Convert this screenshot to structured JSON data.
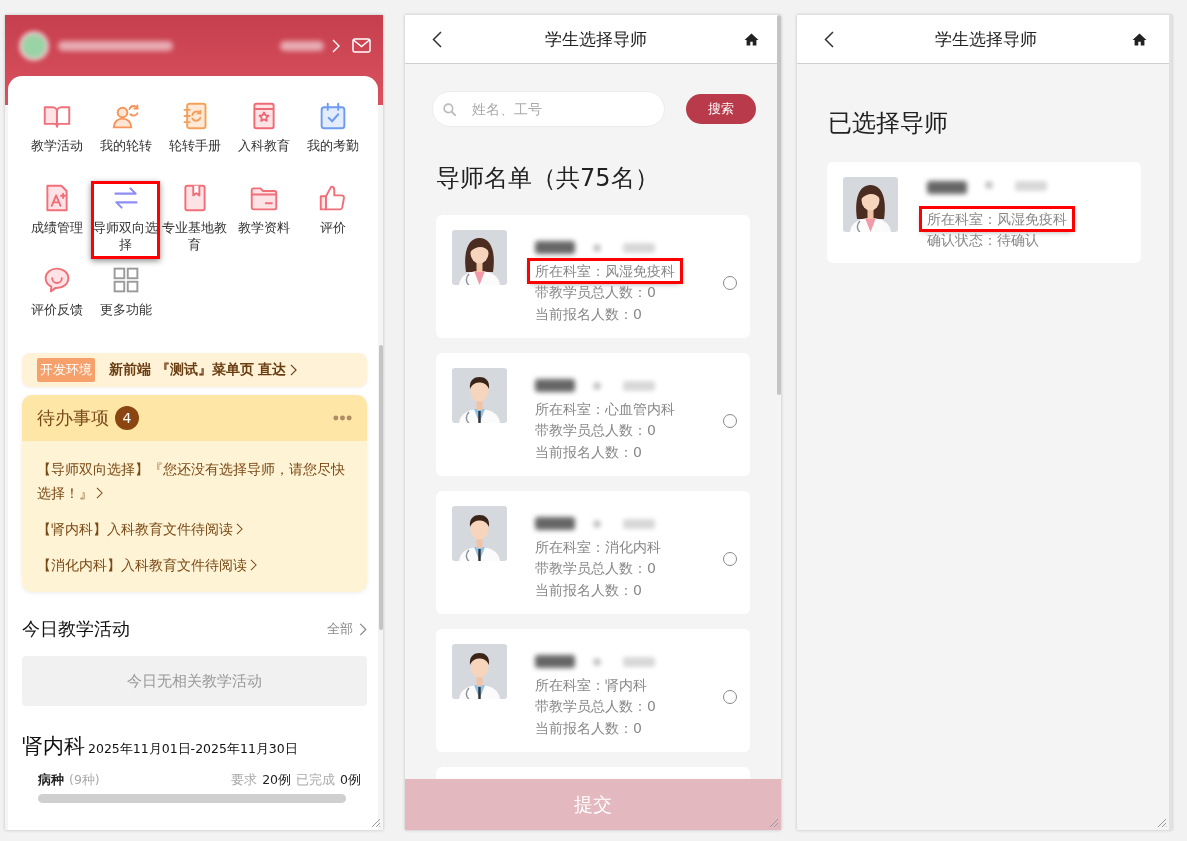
{
  "home_panel": {
    "header": {
      "identity_blurred": true
    },
    "menu": [
      {
        "label": "教学活动",
        "highlighted": false
      },
      {
        "label": "我的轮转",
        "highlighted": false
      },
      {
        "label": "轮转手册",
        "highlighted": false
      },
      {
        "label": "入科教育",
        "highlighted": false
      },
      {
        "label": "我的考勤",
        "highlighted": false
      },
      {
        "label": "成绩管理",
        "highlighted": false
      },
      {
        "label": "导师双向选择",
        "highlighted": true
      },
      {
        "label": "专业基地教育",
        "highlighted": false
      },
      {
        "label": "教学资料",
        "highlighted": false
      },
      {
        "label": "评价",
        "highlighted": false
      },
      {
        "label": "评价反馈",
        "highlighted": false
      },
      {
        "label": "更多功能",
        "highlighted": false
      }
    ],
    "dev_banner": {
      "tag": "开发环境",
      "text": "新前端 『测试』菜单页 直达"
    },
    "todo": {
      "title": "待办事项",
      "count": "4",
      "items": [
        "【导师双向选择】『您还没有选择导师，请您尽快选择！』",
        "【肾内科】入科教育文件待阅读",
        "【消化内科】入科教育文件待阅读"
      ]
    },
    "today": {
      "title": "今日教学活动",
      "more": "全部",
      "empty": "今日无相关教学活动"
    },
    "rotation": {
      "department": "肾内科",
      "period": "2025年11月01日-2025年11月30日",
      "label": "病种",
      "count": "(9种)",
      "required_label": "要求",
      "required": "20例",
      "done_label": "已完成",
      "done": "0例",
      "level": 0
    }
  },
  "select_panel": {
    "title": "学生选择导师",
    "search": {
      "placeholder": "姓名、工号",
      "button": "搜索"
    },
    "list_title": "导师名单（共75名）",
    "tutors": [
      {
        "kind": "female",
        "name_blurred": true,
        "department": "所在科室：风湿免疫科",
        "dept_highlighted": true,
        "students": "带教学员总人数：0",
        "applicants": "当前报名人数：0",
        "selected": false
      },
      {
        "kind": "male",
        "name_blurred": true,
        "department": "所在科室：心血管内科",
        "dept_highlighted": false,
        "students": "带教学员总人数：0",
        "applicants": "当前报名人数：0",
        "selected": false
      },
      {
        "kind": "male",
        "name_blurred": true,
        "department": "所在科室：消化内科",
        "dept_highlighted": false,
        "students": "带教学员总人数：0",
        "applicants": "当前报名人数：0",
        "selected": false
      },
      {
        "kind": "male",
        "name_blurred": true,
        "department": "所在科室：肾内科",
        "dept_highlighted": false,
        "students": "带教学员总人数：0",
        "applicants": "当前报名人数：0",
        "selected": false
      }
    ],
    "submit": {
      "label": "提交",
      "disabled": true
    }
  },
  "selected_panel": {
    "title": "学生选择导师",
    "heading": "已选择导师",
    "tutor": {
      "kind": "female",
      "name_blurred": true,
      "department": "所在科室：风湿免疫科",
      "dept_highlighted": true,
      "status": "确认状态：待确认"
    }
  }
}
